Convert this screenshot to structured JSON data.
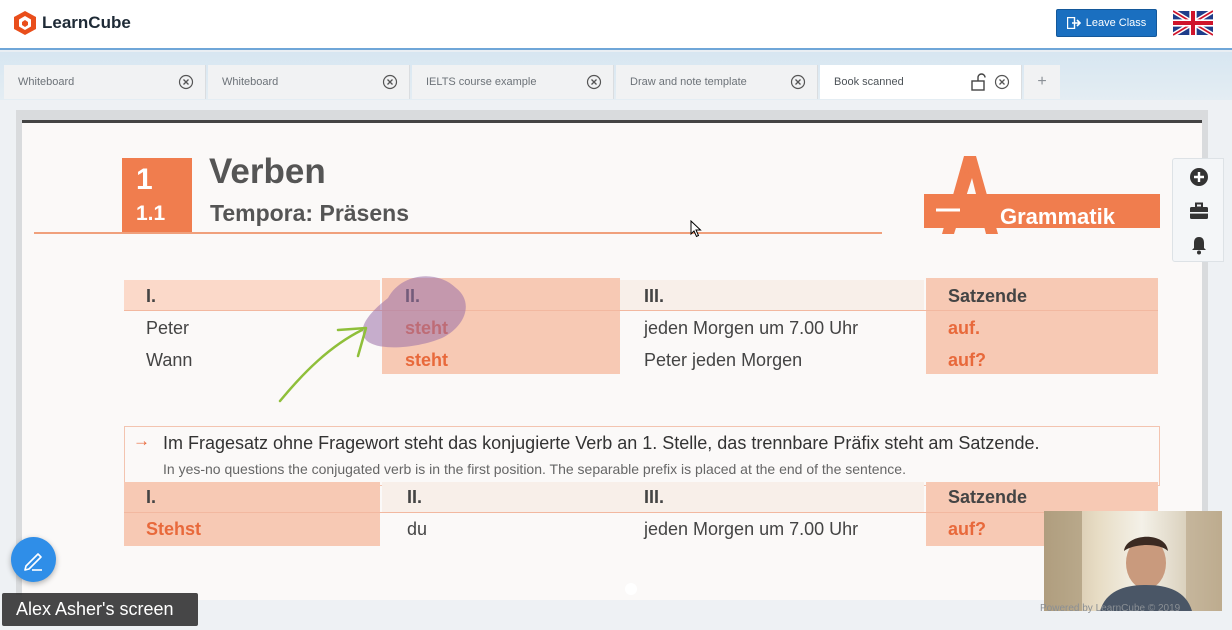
{
  "header": {
    "logo_text": "LearnCube",
    "leave_label": "Leave Class"
  },
  "tabs": [
    {
      "label": "Whiteboard"
    },
    {
      "label": "Whiteboard"
    },
    {
      "label": "IELTS course example"
    },
    {
      "label": "Draw and note template"
    },
    {
      "label": "Book scanned",
      "active": true
    }
  ],
  "tab_add": "+",
  "book": {
    "chapter": "1",
    "section": "1.1",
    "title": "Verben",
    "subtitle": "Tempora: Präsens",
    "badge_letter": "A",
    "badge_text": "Grammatik",
    "table1": {
      "headers": [
        "I.",
        "II.",
        "III.",
        "Satzende"
      ],
      "rows": [
        [
          "Peter",
          "steht",
          "jeden Morgen um 7.00 Uhr",
          "auf."
        ],
        [
          "Wann",
          "steht",
          "Peter jeden Morgen",
          "auf?"
        ]
      ]
    },
    "note": {
      "arrow": "→",
      "main": "Im Fragesatz ohne Fragewort steht das konjugierte Verb an 1. Stelle, das trennbare Präfix steht am Satzende.",
      "sub": "In yes-no questions the conjugated verb is in the first position. The separable prefix is placed at the end of the sentence."
    },
    "table2": {
      "headers": [
        "I.",
        "II.",
        "III.",
        "Satzende"
      ],
      "rows": [
        [
          "Stehst",
          "du",
          "jeden Morgen um 7.00 Uhr",
          "auf?"
        ]
      ]
    }
  },
  "screen_share_label": "Alex Asher's screen",
  "powered_by": "Powered by LearnCube © 2019",
  "colors": {
    "brand_orange": "#f07d4e",
    "accent_blue": "#1a6fc0",
    "highlight_purple": "#9b6fa8",
    "annotation_green": "#8fbf3a"
  }
}
